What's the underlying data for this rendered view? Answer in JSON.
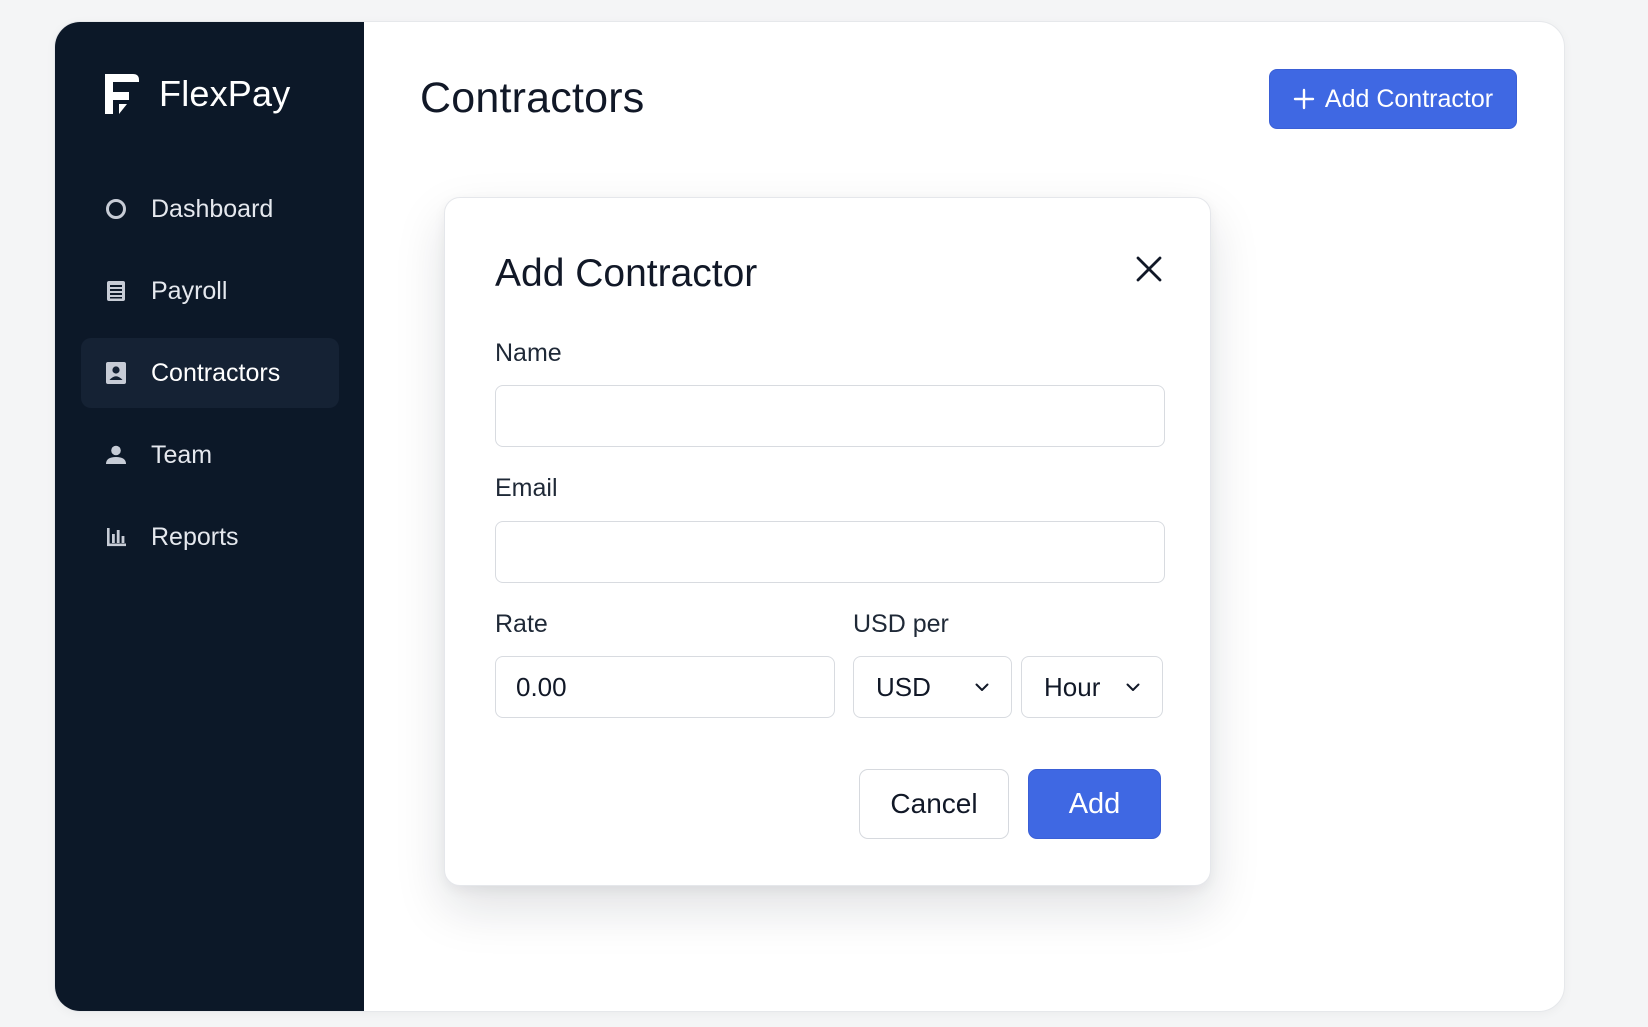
{
  "app": {
    "brand": "FlexPay"
  },
  "sidebar": {
    "items": [
      {
        "label": "Dashboard",
        "icon": "circle-icon",
        "active": false
      },
      {
        "label": "Payroll",
        "icon": "document-list-icon",
        "active": false
      },
      {
        "label": "Contractors",
        "icon": "contact-card-icon",
        "active": true
      },
      {
        "label": "Team",
        "icon": "person-icon",
        "active": false
      },
      {
        "label": "Reports",
        "icon": "bar-chart-icon",
        "active": false
      }
    ]
  },
  "header": {
    "title": "Contractors",
    "add_button_label": "Add Contractor",
    "add_button_icon": "plus-icon"
  },
  "modal": {
    "title": "Add Contractor",
    "close_icon": "close-icon",
    "name": {
      "label": "Name",
      "value": "",
      "placeholder": ""
    },
    "email": {
      "label": "Email",
      "value": "",
      "placeholder": ""
    },
    "rate": {
      "label": "Rate",
      "value": "0.00"
    },
    "usd_per": {
      "label": "USD per",
      "currency": "USD",
      "unit": "Hour"
    },
    "cancel_label": "Cancel",
    "add_label": "Add"
  },
  "colors": {
    "sidebar_bg": "#0c1828",
    "sidebar_active": "#152234",
    "accent": "#3f68e3",
    "page_bg": "#f4f5f6"
  }
}
